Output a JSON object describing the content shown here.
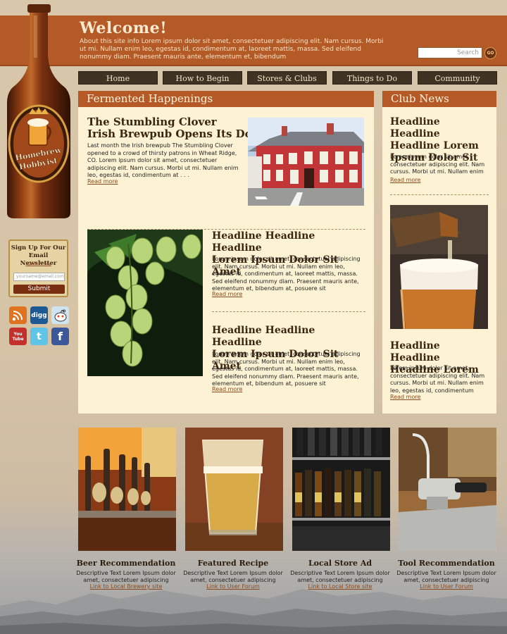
{
  "header": {
    "title": "Welcome!",
    "intro": "About this site info Lorem ipsum dolor sit amet, consectetuer adipiscing elit. Nam cursus. Morbi ut mi. Nullam enim leo, egestas id, condimentum at, laoreet mattis, massa. Sed eleifend nonummy diam. Praesent mauris ante, elementum et, bibendum",
    "search_placeholder": "Search",
    "go_label": "GO"
  },
  "logo": {
    "line1": "Homebrew",
    "line2": "Hobbyist"
  },
  "nav": [
    "Home",
    "How to Begin",
    "Stores & Clubs",
    "Things to Do",
    "Community"
  ],
  "newsletter": {
    "title_line1": "Sign Up For Our",
    "title_line2": "Email Newsletter",
    "spam_policy": "Spam Policy",
    "email_placeholder": "yourname@email.com",
    "submit_label": "Submit"
  },
  "social": [
    {
      "name": "rss-icon",
      "glyph": "))",
      "color": "#e0731f"
    },
    {
      "name": "digg-icon",
      "glyph": "digg",
      "color": "#1d5a94"
    },
    {
      "name": "reddit-icon",
      "glyph": "●",
      "color": "#cfe4f3"
    },
    {
      "name": "youtube-icon",
      "glyph": "You Tube",
      "color": "#c4302b"
    },
    {
      "name": "twitter-icon",
      "glyph": "t",
      "color": "#5fc4e8"
    },
    {
      "name": "facebook-icon",
      "glyph": "f",
      "color": "#3b5998"
    }
  ],
  "fermented": {
    "heading": "Fermented Happenings",
    "articles": [
      {
        "headline_line1": "The Stumbling Clover",
        "headline_line2": "Irish Brewpub Opens Its Doors",
        "body": "Last month the Irish brewpub The Stumbling Clover opened to a crowd of thirsty patrons in Wheat Ridge, CO. Lorem ipsum dolor sit amet, consectetuer adipiscing elit. Nam cursus. Morbi ut mi. Nullam enim leo, egestas id, condimentum at . . .",
        "more": "Read more"
      },
      {
        "headline_line1": "Headline Headline Headline",
        "headline_line2": "Lorem Ipsum Dolor Sit Amet",
        "body": "Lorem ipsum dolor sit amet, consectetuer adipiscing elit. Nam cursus. Morbi ut mi. Nullam enim leo, egestas id, condimentum at, laoreet mattis, massa. Sed eleifend nonummy diam. Praesent mauris ante, elementum et, bibendum at, posuere sit",
        "more": "Read more"
      },
      {
        "headline_line1": "Headline Headline Headline",
        "headline_line2": "Lorem Ipsum Dolor Sit Amet",
        "body": "Lorem ipsum dolor sit amet, consectetuer adipiscing elit. Nam cursus. Morbi ut mi. Nullam enim leo, egestas id, condimentum at, laoreet mattis, massa. Sed eleifend nonummy diam. Praesent mauris ante, elementum et, bibendum at, posuere sit",
        "more": "Read more"
      }
    ]
  },
  "club": {
    "heading": "Club News",
    "items": [
      {
        "headline": "Headline Headline Headline Lorem Ipsum Dolor Sit",
        "body": "Lorem ipsum dolor sit amet, consectetuer adipiscing elit. Nam cursus. Morbi ut mi. Nullam enim",
        "more": "Read more"
      },
      {
        "headline": "Headline Headline Headline Lorem",
        "body": "Lorem ipsum dolor sit amet, consectetuer adipiscing elit. Nam cursus. Morbi ut mi. Nullam enim leo, egestas id, condimentum",
        "more": "Read more"
      }
    ]
  },
  "features": [
    {
      "title": "Beer Recommendation",
      "desc": "Descriptive Text Lorem Ipsum dolor amet, consectetuer adipiscing",
      "link": "Link to Local Brewery site"
    },
    {
      "title": "Featured Recipe",
      "desc": "Descriptive Text Lorem Ipsum dolor amet, consectetuer adipiscing",
      "link": "Link to User Forum"
    },
    {
      "title": "Local Store Ad",
      "desc": "Descriptive Text Lorem Ipsum dolor amet, consectetuer adipiscing",
      "link": "Link to Local Store site"
    },
    {
      "title": "Tool Recommendation",
      "desc": "Descriptive Text Lorem Ipsum dolor amet, consectetuer adipiscing",
      "link": "Link to User Forum"
    }
  ],
  "colors": {
    "accent": "#b55a26",
    "panel": "#fdf2d3",
    "nav_bg": "#3f3323",
    "background": "#d9c7ab"
  }
}
